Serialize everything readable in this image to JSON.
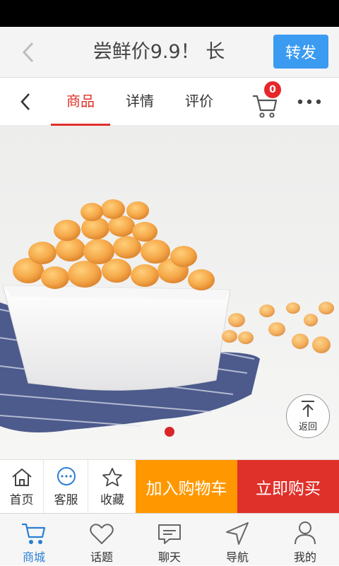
{
  "title_bar": {
    "title": "尝鲜价9.9！ 长",
    "share_label": "转发"
  },
  "tabs": [
    {
      "label": "商品",
      "active": true
    },
    {
      "label": "详情",
      "active": false
    },
    {
      "label": "评价",
      "active": false
    }
  ],
  "cart": {
    "count": "0"
  },
  "carousel": {
    "current": 1,
    "total": 1
  },
  "back_to_top": {
    "label": "返回"
  },
  "action_bar": {
    "home_label": "首页",
    "service_label": "客服",
    "favorite_label": "收藏",
    "add_to_cart_label": "加入购物车",
    "buy_now_label": "立即购买"
  },
  "bottom_nav": [
    {
      "label": "商城",
      "icon": "cart-icon",
      "active": true
    },
    {
      "label": "话题",
      "icon": "heart-icon",
      "active": false
    },
    {
      "label": "聊天",
      "icon": "chat-icon",
      "active": false
    },
    {
      "label": "导航",
      "icon": "navigation-arrow-icon",
      "active": false
    },
    {
      "label": "我的",
      "icon": "user-icon",
      "active": false
    }
  ],
  "colors": {
    "accent_red": "#e0302a",
    "share_blue": "#3a9bf0",
    "add_cart_orange": "#ff9800",
    "nav_active_blue": "#2a7fd4"
  }
}
